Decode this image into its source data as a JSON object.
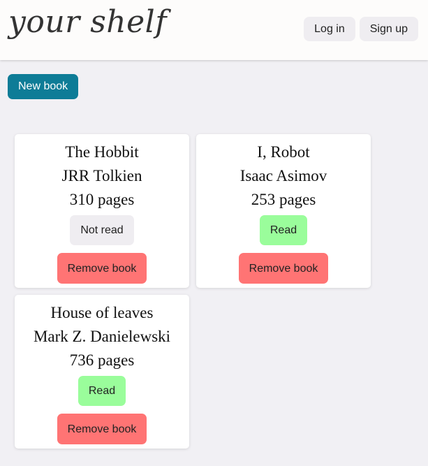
{
  "app": {
    "title": "your shelf"
  },
  "header": {
    "login_label": "Log in",
    "signup_label": "Sign up"
  },
  "toolbar": {
    "new_book_label": "New book"
  },
  "books": [
    {
      "title": "The Hobbit",
      "author": "JRR Tolkien",
      "pages": "310 pages",
      "status": "Not read",
      "remove_label": "Remove book"
    },
    {
      "title": "I, Robot",
      "author": "Isaac Asimov",
      "pages": "253 pages",
      "status": "Read",
      "remove_label": "Remove book"
    },
    {
      "title": "House of leaves",
      "author": "Mark Z. Danielewski",
      "pages": "736 pages",
      "status": "Read",
      "remove_label": "Remove book"
    }
  ],
  "colors": {
    "accent": "#0e7c97",
    "read": "#9afd9b",
    "not_read": "#efedf1",
    "remove": "#ff7474",
    "background": "#f1f0f4"
  }
}
